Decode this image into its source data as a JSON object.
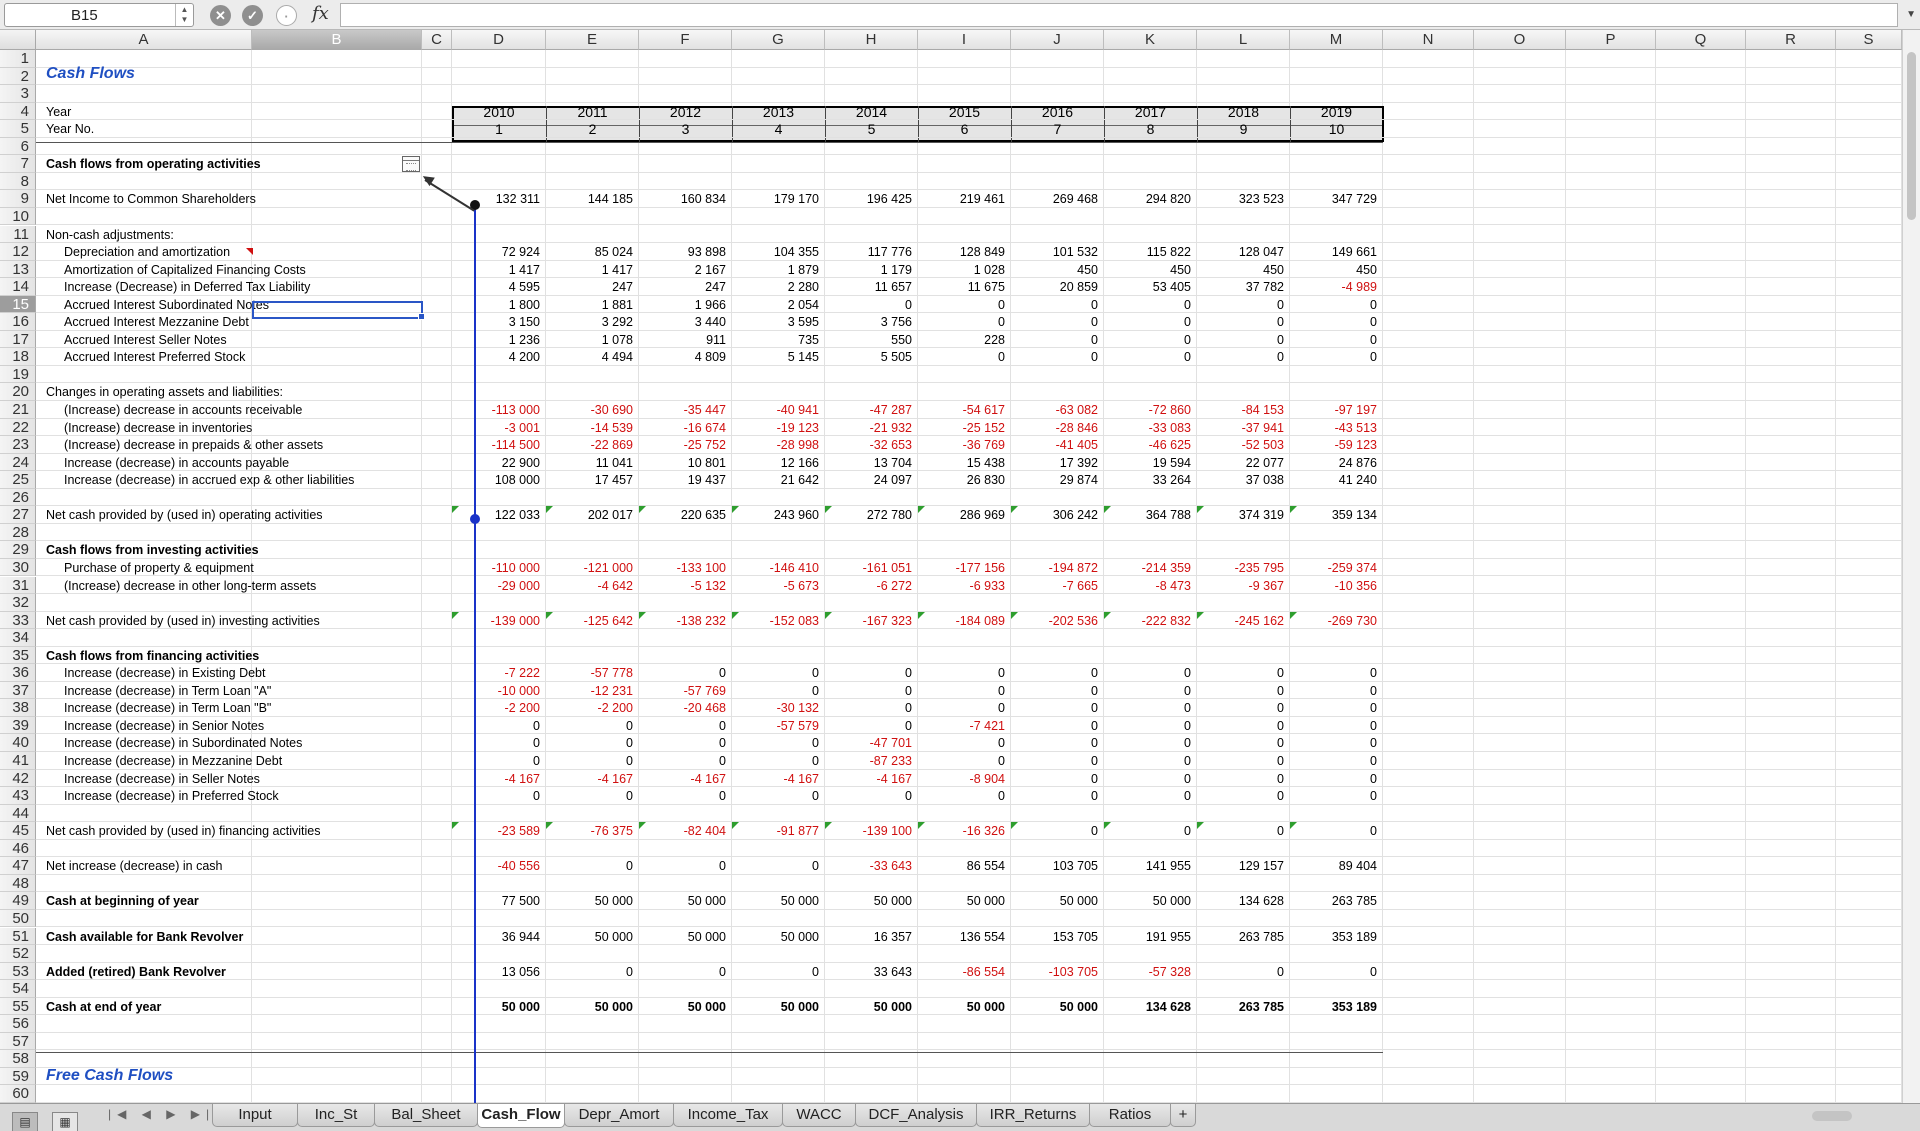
{
  "formula_bar": {
    "cell_ref": "B15",
    "fx": "fx",
    "formula": ""
  },
  "columns": [
    "A",
    "B",
    "C",
    "D",
    "E",
    "F",
    "G",
    "H",
    "I",
    "J",
    "K",
    "L",
    "M",
    "N",
    "O",
    "P",
    "Q",
    "R",
    "S"
  ],
  "selected_column": "B",
  "selected_row": 15,
  "row_count": 60,
  "title": "Cash Flows",
  "title2": "Free Cash Flows",
  "header_rows": [
    {
      "row": 4,
      "label": "Year",
      "values": [
        "2010",
        "2011",
        "2012",
        "2013",
        "2014",
        "2015",
        "2016",
        "2017",
        "2018",
        "2019"
      ]
    },
    {
      "row": 5,
      "label": "Year No.",
      "values": [
        "1",
        "2",
        "3",
        "4",
        "5",
        "6",
        "7",
        "8",
        "9",
        "10"
      ]
    }
  ],
  "rows": [
    {
      "row": 7,
      "label": "Cash flows from operating activities",
      "bold": true
    },
    {
      "row": 9,
      "label": "Net Income to Common Shareholders",
      "values": [
        "132 311",
        "144 185",
        "160 834",
        "179 170",
        "196 425",
        "219 461",
        "269 468",
        "294 820",
        "323 523",
        "347 729"
      ]
    },
    {
      "row": 11,
      "label": "Non-cash adjustments:"
    },
    {
      "row": 12,
      "label": "Depreciation and amortization",
      "indent": true,
      "values": [
        "72 924",
        "85 024",
        "93 898",
        "104 355",
        "117 776",
        "128 849",
        "101 532",
        "115 822",
        "128 047",
        "149 661"
      ]
    },
    {
      "row": 13,
      "label": "Amortization of Capitalized Financing Costs",
      "indent": true,
      "values": [
        "1 417",
        "1 417",
        "2 167",
        "1 879",
        "1 179",
        "1 028",
        "450",
        "450",
        "450",
        "450"
      ]
    },
    {
      "row": 14,
      "label": "Increase (Decrease) in Deferred Tax Liability",
      "indent": true,
      "values": [
        "4 595",
        "247",
        "247",
        "2 280",
        "11 657",
        "11 675",
        "20 859",
        "53 405",
        "37 782",
        "-4 989"
      ]
    },
    {
      "row": 15,
      "label": "Accrued Interest Subordinated Notes",
      "indent": true,
      "values": [
        "1 800",
        "1 881",
        "1 966",
        "2 054",
        "0",
        "0",
        "0",
        "0",
        "0",
        "0"
      ]
    },
    {
      "row": 16,
      "label": "Accrued Interest Mezzanine Debt",
      "indent": true,
      "values": [
        "3 150",
        "3 292",
        "3 440",
        "3 595",
        "3 756",
        "0",
        "0",
        "0",
        "0",
        "0"
      ]
    },
    {
      "row": 17,
      "label": "Accrued Interest Seller Notes",
      "indent": true,
      "values": [
        "1 236",
        "1 078",
        "911",
        "735",
        "550",
        "228",
        "0",
        "0",
        "0",
        "0"
      ]
    },
    {
      "row": 18,
      "label": "Accrued Interest Preferred Stock",
      "indent": true,
      "values": [
        "4 200",
        "4 494",
        "4 809",
        "5 145",
        "5 505",
        "0",
        "0",
        "0",
        "0",
        "0"
      ]
    },
    {
      "row": 20,
      "label": "Changes in operating assets and liabilities:"
    },
    {
      "row": 21,
      "label": "(Increase) decrease in accounts receivable",
      "indent": true,
      "values": [
        "-113 000",
        "-30 690",
        "-35 447",
        "-40 941",
        "-47 287",
        "-54 617",
        "-63 082",
        "-72 860",
        "-84 153",
        "-97 197"
      ]
    },
    {
      "row": 22,
      "label": "(Increase) decrease in inventories",
      "indent": true,
      "values": [
        "-3 001",
        "-14 539",
        "-16 674",
        "-19 123",
        "-21 932",
        "-25 152",
        "-28 846",
        "-33 083",
        "-37 941",
        "-43 513"
      ]
    },
    {
      "row": 23,
      "label": "(Increase) decrease in prepaids & other assets",
      "indent": true,
      "values": [
        "-114 500",
        "-22 869",
        "-25 752",
        "-28 998",
        "-32 653",
        "-36 769",
        "-41 405",
        "-46 625",
        "-52 503",
        "-59 123"
      ]
    },
    {
      "row": 24,
      "label": "Increase (decrease) in accounts payable",
      "indent": true,
      "values": [
        "22 900",
        "11 041",
        "10 801",
        "12 166",
        "13 704",
        "15 438",
        "17 392",
        "19 594",
        "22 077",
        "24 876"
      ]
    },
    {
      "row": 25,
      "label": "Increase (decrease) in accrued exp & other liabilities",
      "indent": true,
      "values": [
        "108 000",
        "17 457",
        "19 437",
        "21 642",
        "24 097",
        "26 830",
        "29 874",
        "33 264",
        "37 038",
        "41 240"
      ]
    },
    {
      "row": 27,
      "label": "Net cash provided by (used in) operating activities",
      "values": [
        "122 033",
        "202 017",
        "220 635",
        "243 960",
        "272 780",
        "286 969",
        "306 242",
        "364 788",
        "374 319",
        "359 134"
      ],
      "flags": true
    },
    {
      "row": 29,
      "label": "Cash flows from investing activities",
      "bold": true
    },
    {
      "row": 30,
      "label": "Purchase of property & equipment",
      "indent": true,
      "values": [
        "-110 000",
        "-121 000",
        "-133 100",
        "-146 410",
        "-161 051",
        "-177 156",
        "-194 872",
        "-214 359",
        "-235 795",
        "-259 374"
      ]
    },
    {
      "row": 31,
      "label": "(Increase) decrease in other long-term assets",
      "indent": true,
      "values": [
        "-29 000",
        "-4 642",
        "-5 132",
        "-5 673",
        "-6 272",
        "-6 933",
        "-7 665",
        "-8 473",
        "-9 367",
        "-10 356"
      ]
    },
    {
      "row": 33,
      "label": "Net cash provided by (used in) investing activities",
      "values": [
        "-139 000",
        "-125 642",
        "-138 232",
        "-152 083",
        "-167 323",
        "-184 089",
        "-202 536",
        "-222 832",
        "-245 162",
        "-269 730"
      ],
      "flags": true
    },
    {
      "row": 35,
      "label": "Cash flows from financing activities",
      "bold": true
    },
    {
      "row": 36,
      "label": "Increase (decrease) in Existing Debt",
      "indent": true,
      "values": [
        "-7 222",
        "-57 778",
        "0",
        "0",
        "0",
        "0",
        "0",
        "0",
        "0",
        "0"
      ]
    },
    {
      "row": 37,
      "label": "Increase (decrease) in Term Loan \"A\"",
      "indent": true,
      "values": [
        "-10 000",
        "-12 231",
        "-57 769",
        "0",
        "0",
        "0",
        "0",
        "0",
        "0",
        "0"
      ]
    },
    {
      "row": 38,
      "label": "Increase (decrease) in Term Loan \"B\"",
      "indent": true,
      "values": [
        "-2 200",
        "-2 200",
        "-20 468",
        "-30 132",
        "0",
        "0",
        "0",
        "0",
        "0",
        "0"
      ]
    },
    {
      "row": 39,
      "label": "Increase (decrease) in Senior Notes",
      "indent": true,
      "values": [
        "0",
        "0",
        "0",
        "-57 579",
        "0",
        "-7 421",
        "0",
        "0",
        "0",
        "0"
      ]
    },
    {
      "row": 40,
      "label": "Increase (decrease) in Subordinated Notes",
      "indent": true,
      "values": [
        "0",
        "0",
        "0",
        "0",
        "-47 701",
        "0",
        "0",
        "0",
        "0",
        "0"
      ]
    },
    {
      "row": 41,
      "label": "Increase (decrease) in Mezzanine Debt",
      "indent": true,
      "values": [
        "0",
        "0",
        "0",
        "0",
        "-87 233",
        "0",
        "0",
        "0",
        "0",
        "0"
      ]
    },
    {
      "row": 42,
      "label": "Increase (decrease) in Seller Notes",
      "indent": true,
      "values": [
        "-4 167",
        "-4 167",
        "-4 167",
        "-4 167",
        "-4 167",
        "-8 904",
        "0",
        "0",
        "0",
        "0"
      ]
    },
    {
      "row": 43,
      "label": "Increase (decrease) in Preferred Stock",
      "indent": true,
      "values": [
        "0",
        "0",
        "0",
        "0",
        "0",
        "0",
        "0",
        "0",
        "0",
        "0"
      ]
    },
    {
      "row": 45,
      "label": "Net cash provided by (used in) financing activities",
      "values": [
        "-23 589",
        "-76 375",
        "-82 404",
        "-91 877",
        "-139 100",
        "-16 326",
        "0",
        "0",
        "0",
        "0"
      ],
      "flags": true
    },
    {
      "row": 47,
      "label": "Net increase (decrease) in cash",
      "values": [
        "-40 556",
        "0",
        "0",
        "0",
        "-33 643",
        "86 554",
        "103 705",
        "141 955",
        "129 157",
        "89 404"
      ]
    },
    {
      "row": 49,
      "label": "Cash at beginning of year",
      "bold": true,
      "values": [
        "77 500",
        "50 000",
        "50 000",
        "50 000",
        "50 000",
        "50 000",
        "50 000",
        "50 000",
        "134 628",
        "263 785"
      ]
    },
    {
      "row": 51,
      "label": "Cash available for Bank Revolver",
      "bold": true,
      "values": [
        "36 944",
        "50 000",
        "50 000",
        "50 000",
        "16 357",
        "136 554",
        "153 705",
        "191 955",
        "263 785",
        "353 189"
      ]
    },
    {
      "row": 53,
      "label": "Added (retired) Bank Revolver",
      "bold": true,
      "values": [
        "13 056",
        "0",
        "0",
        "0",
        "33 643",
        "-86 554",
        "-103 705",
        "-57 328",
        "0",
        "0"
      ]
    },
    {
      "row": 55,
      "label": "Cash at end of year",
      "bold": true,
      "boldvals": true,
      "values": [
        "50 000",
        "50 000",
        "50 000",
        "50 000",
        "50 000",
        "50 000",
        "50 000",
        "134 628",
        "263 785",
        "353 189"
      ]
    }
  ],
  "sheet_tabs": [
    "Input",
    "Inc_St",
    "Bal_Sheet",
    "Cash_Flow",
    "Depr_Amort",
    "Income_Tax",
    "WACC",
    "DCF_Analysis",
    "IRR_Returns",
    "Ratios"
  ],
  "active_tab": "Cash_Flow",
  "add_tab": "+",
  "colors": {
    "negative": "#d01010",
    "title": "#1f4fc2",
    "trace": "#1a33c8",
    "selection": "#2a56c6"
  }
}
